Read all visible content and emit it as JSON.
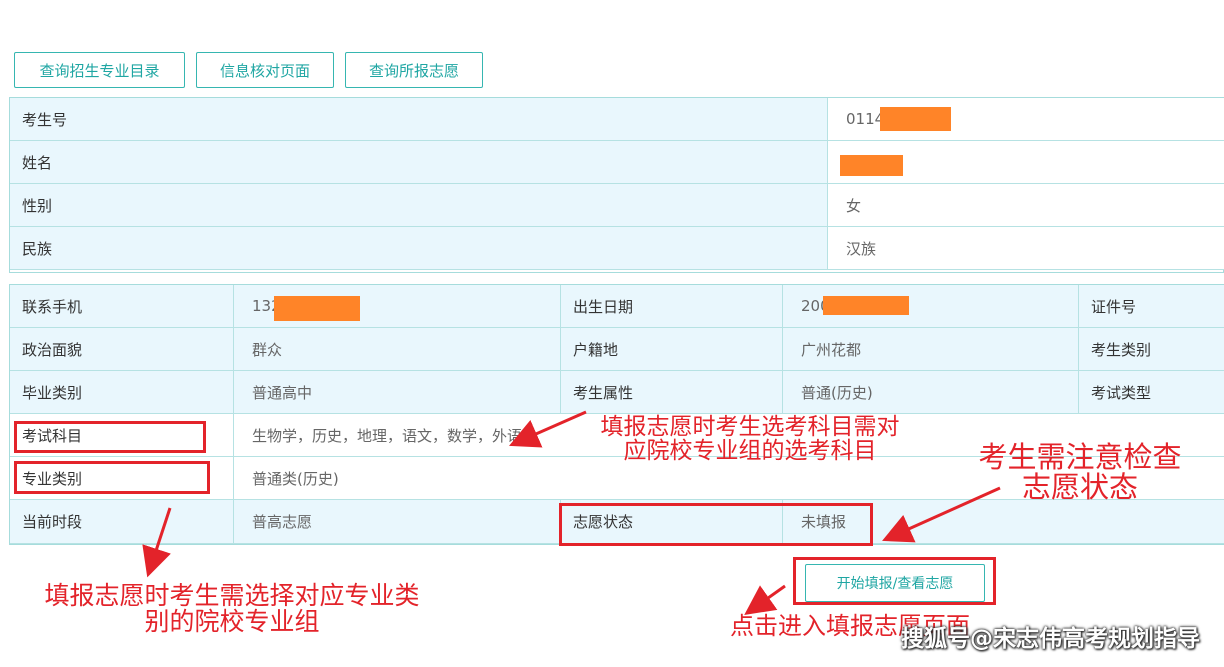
{
  "toolbar": {
    "btn_catalog": "查询招生专业目录",
    "btn_verify": "信息核对页面",
    "btn_query": "查询所报志愿"
  },
  "info": {
    "exam_no_label": "考生号",
    "exam_no_value": "0114",
    "name_label": "姓名",
    "name_value": "",
    "gender_label": "性别",
    "gender_value": "女",
    "ethnic_label": "民族",
    "ethnic_value": "汉族"
  },
  "details": {
    "phone_label": "联系手机",
    "phone_value": "132",
    "birth_label": "出生日期",
    "birth_value": "200",
    "id_label": "证件号",
    "political_label": "政治面貌",
    "political_value": "群众",
    "household_label": "户籍地",
    "household_value": "广州花都",
    "candtype_label": "考生类别",
    "gradtype_label": "毕业类别",
    "gradtype_value": "普通高中",
    "attr_label": "考生属性",
    "attr_value": "普通(历史)",
    "examtype_label": "考试类型",
    "subjects_label": "考试科目",
    "subjects_value": "生物学，历史，地理，语文，数学，外语",
    "major_label": "专业类别",
    "major_value": "普通类(历史)",
    "period_label": "当前时段",
    "period_value": "普高志愿",
    "status_label": "志愿状态",
    "status_value": "未填报"
  },
  "action": {
    "start_label": "开始填报/查看志愿"
  },
  "annotations": {
    "subjects_note_1": "填报志愿时考生选考科目需对",
    "subjects_note_2": "应院校专业组的选考科目",
    "status_note_1": "考生需注意检查",
    "status_note_2": "志愿状态",
    "major_note_1": "填报志愿时考生需选择对应专业类",
    "major_note_2": "别的院校专业组",
    "start_note": "点击进入填报志愿页面"
  },
  "watermark": "搜狐号@宋志伟高考规划指导",
  "colors": {
    "accent": "#36b6b1",
    "cell_bg": "#e9f7fd",
    "redaction": "#ff8428",
    "annotation": "#e3232a"
  }
}
